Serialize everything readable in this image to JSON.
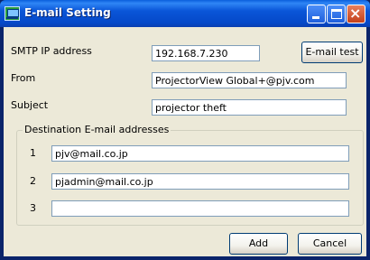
{
  "window": {
    "title": "E-mail Setting"
  },
  "smtp": {
    "label": "SMTP IP address",
    "value": "192.168.7.230"
  },
  "from": {
    "label": "From",
    "value": "ProjectorView Global+@pjv.com"
  },
  "subject": {
    "label": "Subject",
    "value": "projector theft"
  },
  "destinations": {
    "label": "Destination E-mail addresses",
    "items": [
      {
        "num": "1",
        "value": "pjv@mail.co.jp"
      },
      {
        "num": "2",
        "value": "pjadmin@mail.co.jp"
      },
      {
        "num": "3",
        "value": ""
      }
    ]
  },
  "buttons": {
    "email_test": "E-mail test",
    "add": "Add",
    "cancel": "Cancel"
  },
  "icons": {
    "app": "monitor-app-icon",
    "minimize": "minimize-icon",
    "maximize": "maximize-icon",
    "close": "close-icon"
  }
}
